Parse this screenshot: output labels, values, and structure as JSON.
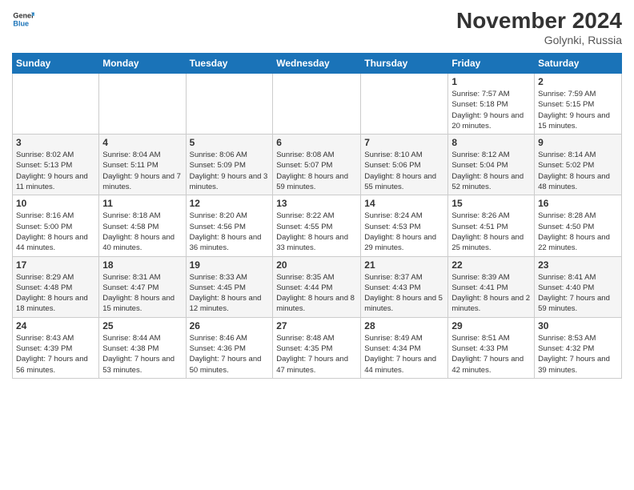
{
  "header": {
    "logo_line1": "General",
    "logo_line2": "Blue",
    "month_title": "November 2024",
    "location": "Golynki, Russia"
  },
  "weekdays": [
    "Sunday",
    "Monday",
    "Tuesday",
    "Wednesday",
    "Thursday",
    "Friday",
    "Saturday"
  ],
  "weeks": [
    [
      {
        "day": "",
        "info": ""
      },
      {
        "day": "",
        "info": ""
      },
      {
        "day": "",
        "info": ""
      },
      {
        "day": "",
        "info": ""
      },
      {
        "day": "",
        "info": ""
      },
      {
        "day": "1",
        "info": "Sunrise: 7:57 AM\nSunset: 5:18 PM\nDaylight: 9 hours and 20 minutes."
      },
      {
        "day": "2",
        "info": "Sunrise: 7:59 AM\nSunset: 5:15 PM\nDaylight: 9 hours and 15 minutes."
      }
    ],
    [
      {
        "day": "3",
        "info": "Sunrise: 8:02 AM\nSunset: 5:13 PM\nDaylight: 9 hours and 11 minutes."
      },
      {
        "day": "4",
        "info": "Sunrise: 8:04 AM\nSunset: 5:11 PM\nDaylight: 9 hours and 7 minutes."
      },
      {
        "day": "5",
        "info": "Sunrise: 8:06 AM\nSunset: 5:09 PM\nDaylight: 9 hours and 3 minutes."
      },
      {
        "day": "6",
        "info": "Sunrise: 8:08 AM\nSunset: 5:07 PM\nDaylight: 8 hours and 59 minutes."
      },
      {
        "day": "7",
        "info": "Sunrise: 8:10 AM\nSunset: 5:06 PM\nDaylight: 8 hours and 55 minutes."
      },
      {
        "day": "8",
        "info": "Sunrise: 8:12 AM\nSunset: 5:04 PM\nDaylight: 8 hours and 52 minutes."
      },
      {
        "day": "9",
        "info": "Sunrise: 8:14 AM\nSunset: 5:02 PM\nDaylight: 8 hours and 48 minutes."
      }
    ],
    [
      {
        "day": "10",
        "info": "Sunrise: 8:16 AM\nSunset: 5:00 PM\nDaylight: 8 hours and 44 minutes."
      },
      {
        "day": "11",
        "info": "Sunrise: 8:18 AM\nSunset: 4:58 PM\nDaylight: 8 hours and 40 minutes."
      },
      {
        "day": "12",
        "info": "Sunrise: 8:20 AM\nSunset: 4:56 PM\nDaylight: 8 hours and 36 minutes."
      },
      {
        "day": "13",
        "info": "Sunrise: 8:22 AM\nSunset: 4:55 PM\nDaylight: 8 hours and 33 minutes."
      },
      {
        "day": "14",
        "info": "Sunrise: 8:24 AM\nSunset: 4:53 PM\nDaylight: 8 hours and 29 minutes."
      },
      {
        "day": "15",
        "info": "Sunrise: 8:26 AM\nSunset: 4:51 PM\nDaylight: 8 hours and 25 minutes."
      },
      {
        "day": "16",
        "info": "Sunrise: 8:28 AM\nSunset: 4:50 PM\nDaylight: 8 hours and 22 minutes."
      }
    ],
    [
      {
        "day": "17",
        "info": "Sunrise: 8:29 AM\nSunset: 4:48 PM\nDaylight: 8 hours and 18 minutes."
      },
      {
        "day": "18",
        "info": "Sunrise: 8:31 AM\nSunset: 4:47 PM\nDaylight: 8 hours and 15 minutes."
      },
      {
        "day": "19",
        "info": "Sunrise: 8:33 AM\nSunset: 4:45 PM\nDaylight: 8 hours and 12 minutes."
      },
      {
        "day": "20",
        "info": "Sunrise: 8:35 AM\nSunset: 4:44 PM\nDaylight: 8 hours and 8 minutes."
      },
      {
        "day": "21",
        "info": "Sunrise: 8:37 AM\nSunset: 4:43 PM\nDaylight: 8 hours and 5 minutes."
      },
      {
        "day": "22",
        "info": "Sunrise: 8:39 AM\nSunset: 4:41 PM\nDaylight: 8 hours and 2 minutes."
      },
      {
        "day": "23",
        "info": "Sunrise: 8:41 AM\nSunset: 4:40 PM\nDaylight: 7 hours and 59 minutes."
      }
    ],
    [
      {
        "day": "24",
        "info": "Sunrise: 8:43 AM\nSunset: 4:39 PM\nDaylight: 7 hours and 56 minutes."
      },
      {
        "day": "25",
        "info": "Sunrise: 8:44 AM\nSunset: 4:38 PM\nDaylight: 7 hours and 53 minutes."
      },
      {
        "day": "26",
        "info": "Sunrise: 8:46 AM\nSunset: 4:36 PM\nDaylight: 7 hours and 50 minutes."
      },
      {
        "day": "27",
        "info": "Sunrise: 8:48 AM\nSunset: 4:35 PM\nDaylight: 7 hours and 47 minutes."
      },
      {
        "day": "28",
        "info": "Sunrise: 8:49 AM\nSunset: 4:34 PM\nDaylight: 7 hours and 44 minutes."
      },
      {
        "day": "29",
        "info": "Sunrise: 8:51 AM\nSunset: 4:33 PM\nDaylight: 7 hours and 42 minutes."
      },
      {
        "day": "30",
        "info": "Sunrise: 8:53 AM\nSunset: 4:32 PM\nDaylight: 7 hours and 39 minutes."
      }
    ]
  ]
}
